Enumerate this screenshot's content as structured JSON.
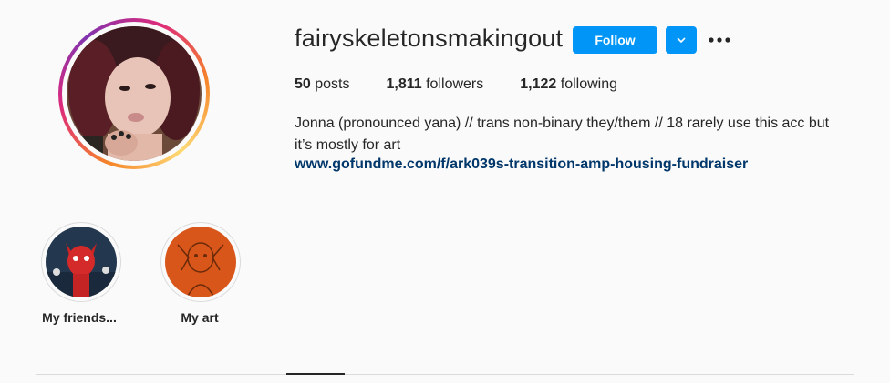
{
  "profile": {
    "username": "fairyskeletonsmakingout",
    "follow_label": "Follow",
    "dropdown_icon": "chevron-down-icon",
    "more_icon": "more-options-icon",
    "stats": {
      "posts_count": "50",
      "posts_label": "posts",
      "followers_count": "1,811",
      "followers_label": "followers",
      "following_count": "1,122",
      "following_label": "following"
    },
    "bio_line1": "Jonna (pronounced yana) // trans non-binary they/them // 18 rarely use this acc but",
    "bio_line2": "it’s mostly for art",
    "link": "www.gofundme.com/f/ark039s-transition-amp-housing-fundraiser"
  },
  "highlights": [
    {
      "label": "My friends..."
    },
    {
      "label": "My art"
    }
  ],
  "colors": {
    "accent": "#0095f6",
    "link": "#00376b",
    "text": "#262626",
    "background": "#fafafa"
  }
}
